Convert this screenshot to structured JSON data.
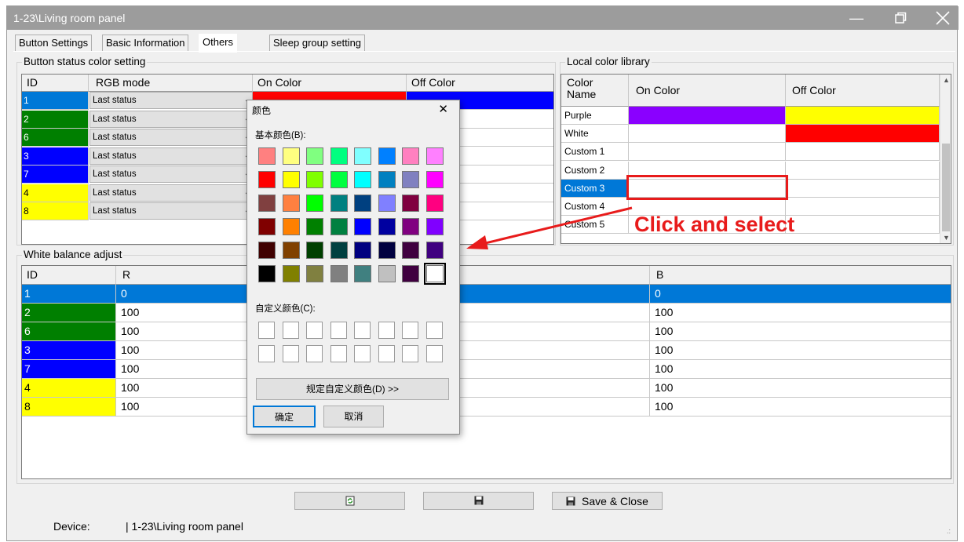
{
  "window": {
    "title": "1-23\\Living room panel",
    "minimize_icon": "minimize-icon",
    "maximize_icon": "restore-icon",
    "close_icon": "close-icon"
  },
  "tabs": [
    {
      "label": "Button Settings"
    },
    {
      "label": "Basic Information"
    },
    {
      "label": "Others",
      "active": true
    },
    {
      "label": "Sleep group setting"
    }
  ],
  "button_status": {
    "group_label": "Button status color setting",
    "headers": {
      "id": "ID",
      "rgb_mode": "RGB mode",
      "on_color": "On Color",
      "off_color": "Off Color"
    },
    "rows": [
      {
        "id": "1",
        "id_color": "#0078d7",
        "mode": "Last status",
        "on": "#ff0000",
        "off": "#0000ff"
      },
      {
        "id": "2",
        "id_color": "#007f00",
        "mode": "Last status"
      },
      {
        "id": "6",
        "id_color": "#007f00",
        "mode": "Last status"
      },
      {
        "id": "3",
        "id_color": "#0000ff",
        "mode": "Last status"
      },
      {
        "id": "7",
        "id_color": "#0000ff",
        "mode": "Last status"
      },
      {
        "id": "4",
        "id_color": "#ffff00",
        "mode": "Last status"
      },
      {
        "id": "8",
        "id_color": "#ffff00",
        "mode": "Last status"
      }
    ]
  },
  "color_library": {
    "group_label": "Local color library",
    "headers": {
      "name_line1": "Color",
      "name_line2": "Name",
      "on_color": "On Color",
      "off_color": "Off Color"
    },
    "rows": [
      {
        "name": "Purple",
        "on": "#8a00ff",
        "off": "#ffff00"
      },
      {
        "name": "White",
        "on": "#ffffff",
        "off": "#ff0000"
      },
      {
        "name": "Custom 1",
        "on": "#ffffff",
        "off": "#ffffff"
      },
      {
        "name": "Custom 2",
        "on": "#ffffff",
        "off": "#ffffff"
      },
      {
        "name": "Custom 3",
        "on": "#ffffff",
        "off": "#ffffff",
        "selected": true
      },
      {
        "name": "Custom 4",
        "on": "#ffffff",
        "off": "#ffffff"
      },
      {
        "name": "Custom 5",
        "on": "#ffffff",
        "off": "#ffffff"
      }
    ]
  },
  "white_balance": {
    "group_label": "White balance adjust",
    "headers": {
      "id": "ID",
      "r": "R",
      "b": "B"
    },
    "rows": [
      {
        "id": "1",
        "id_color": "#0078d7",
        "r": "0",
        "b": "0",
        "selected": true
      },
      {
        "id": "2",
        "id_color": "#007f00",
        "r": "100",
        "b": "100"
      },
      {
        "id": "6",
        "id_color": "#007f00",
        "r": "100",
        "b": "100"
      },
      {
        "id": "3",
        "id_color": "#0000ff",
        "r": "100",
        "b": "100"
      },
      {
        "id": "7",
        "id_color": "#0000ff",
        "r": "100",
        "b": "100"
      },
      {
        "id": "4",
        "id_color": "#ffff00",
        "r": "100",
        "b": "100"
      },
      {
        "id": "8",
        "id_color": "#ffff00",
        "r": "100",
        "b": "100"
      }
    ]
  },
  "color_dialog": {
    "title": "颜色",
    "basic_label": "基本颜色(B):",
    "custom_label": "自定义颜色(C):",
    "define_custom_button": "规定自定义颜色(D) >>",
    "ok_button": "确定",
    "cancel_button": "取消",
    "basic_colors": [
      "#ff8080",
      "#ffff80",
      "#80ff80",
      "#00ff80",
      "#80ffff",
      "#0080ff",
      "#ff80c0",
      "#ff80ff",
      "#ff0000",
      "#ffff00",
      "#80ff00",
      "#00ff40",
      "#00ffff",
      "#0080c0",
      "#8080c0",
      "#ff00ff",
      "#804040",
      "#ff8040",
      "#00ff00",
      "#008080",
      "#004080",
      "#8080ff",
      "#800040",
      "#ff0080",
      "#800000",
      "#ff8000",
      "#008000",
      "#008040",
      "#0000ff",
      "#0000a0",
      "#800080",
      "#8000ff",
      "#400000",
      "#804000",
      "#004000",
      "#004040",
      "#000080",
      "#000040",
      "#400040",
      "#400080",
      "#000000",
      "#808000",
      "#808040",
      "#808080",
      "#408080",
      "#c0c0c0",
      "#400040",
      "#ffffff"
    ]
  },
  "annotation": {
    "text": "Click and select",
    "color": "#e81b1b"
  },
  "toolbar": {
    "refresh_icon": "refresh-icon",
    "save_icon": "floppy-icon",
    "save_close_label": "Save & Close"
  },
  "status": {
    "device_label": "Device:",
    "device_value": "| 1-23\\Living room panel"
  }
}
